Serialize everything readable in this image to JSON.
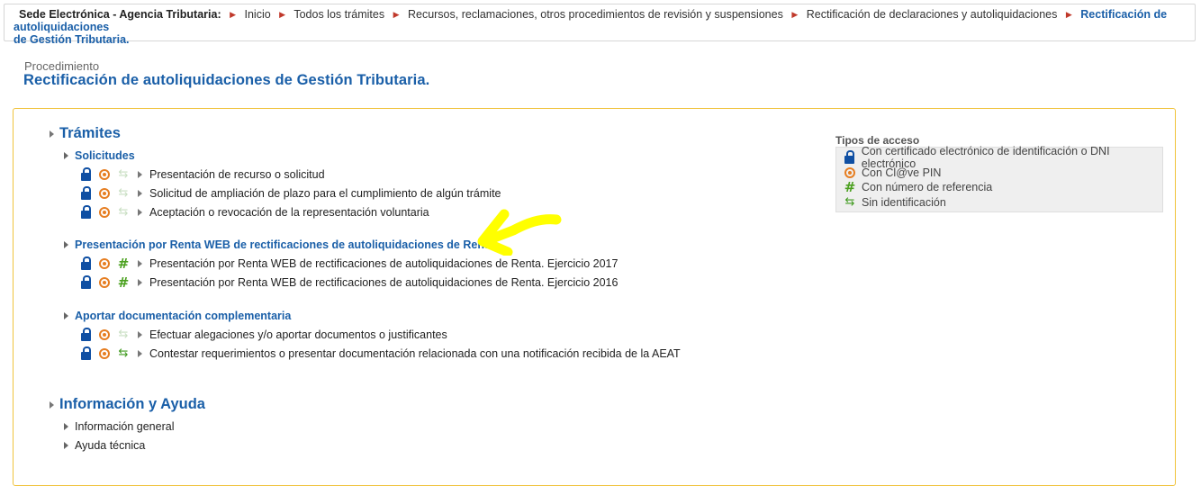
{
  "breadcrumb": {
    "root": "Sede Electrónica - Agencia Tributaria:",
    "items": [
      "Inicio",
      "Todos los trámites",
      "Recursos, reclamaciones, otros procedimientos de revisión y suspensiones",
      "Rectificación de declaraciones y autoliquidaciones"
    ],
    "current_line1": "Rectificación de autoliquidaciones",
    "current_line2": "de Gestión Tributaria."
  },
  "page": {
    "label": "Procedimiento",
    "title": "Rectificación de autoliquidaciones de Gestión Tributaria."
  },
  "tramites": {
    "title": "Trámites",
    "groups": [
      {
        "title": "Solicitudes",
        "items": [
          {
            "label": "Presentación de recurso o solicitud",
            "icons": [
              "lock-icon",
              "clave-pin-icon",
              "no-identification-icon-disabled"
            ]
          },
          {
            "label": "Solicitud de ampliación de plazo para el cumplimiento de algún trámite",
            "icons": [
              "lock-icon",
              "clave-pin-icon",
              "no-identification-icon-disabled"
            ]
          },
          {
            "label": "Aceptación o revocación de la representación voluntaria",
            "icons": [
              "lock-icon",
              "clave-pin-icon",
              "no-identification-icon-disabled"
            ]
          }
        ]
      },
      {
        "title": "Presentación por Renta WEB de rectificaciones de autoliquidaciones de Renta",
        "items": [
          {
            "label": "Presentación por Renta WEB de rectificaciones de autoliquidaciones de Renta. Ejercicio 2017",
            "icons": [
              "lock-icon",
              "clave-pin-icon",
              "hash-icon"
            ]
          },
          {
            "label": "Presentación por Renta WEB de rectificaciones de autoliquidaciones de Renta. Ejercicio 2016",
            "icons": [
              "lock-icon",
              "clave-pin-icon",
              "hash-icon"
            ]
          }
        ]
      },
      {
        "title": "Aportar documentación complementaria",
        "items": [
          {
            "label": "Efectuar alegaciones y/o aportar documentos o justificantes",
            "icons": [
              "lock-icon",
              "clave-pin-icon",
              "no-identification-icon-disabled"
            ]
          },
          {
            "label": "Contestar requerimientos o presentar documentación relacionada con una notificación recibida de la AEAT",
            "icons": [
              "lock-icon",
              "clave-pin-icon",
              "no-identification-icon"
            ]
          }
        ]
      }
    ]
  },
  "info": {
    "title": "Información y Ayuda",
    "items": [
      "Información general",
      "Ayuda técnica"
    ]
  },
  "access_legend": {
    "title": "Tipos de acceso",
    "items": [
      {
        "icon": "lock-icon",
        "label": "Con certificado electrónico de identificación o DNI electrónico"
      },
      {
        "icon": "clave-pin-icon",
        "label": "Con Cl@ve PIN"
      },
      {
        "icon": "hash-icon",
        "label": "Con número de referencia"
      },
      {
        "icon": "no-identification-icon",
        "label": "Sin identificación"
      }
    ]
  },
  "colors": {
    "link_blue": "#1a5fa8",
    "panel_border": "#f0c33c",
    "lock": "#0f4fa3",
    "clave": "#e67e22",
    "hash": "#4aa01e",
    "annotation": "#ffff00"
  }
}
